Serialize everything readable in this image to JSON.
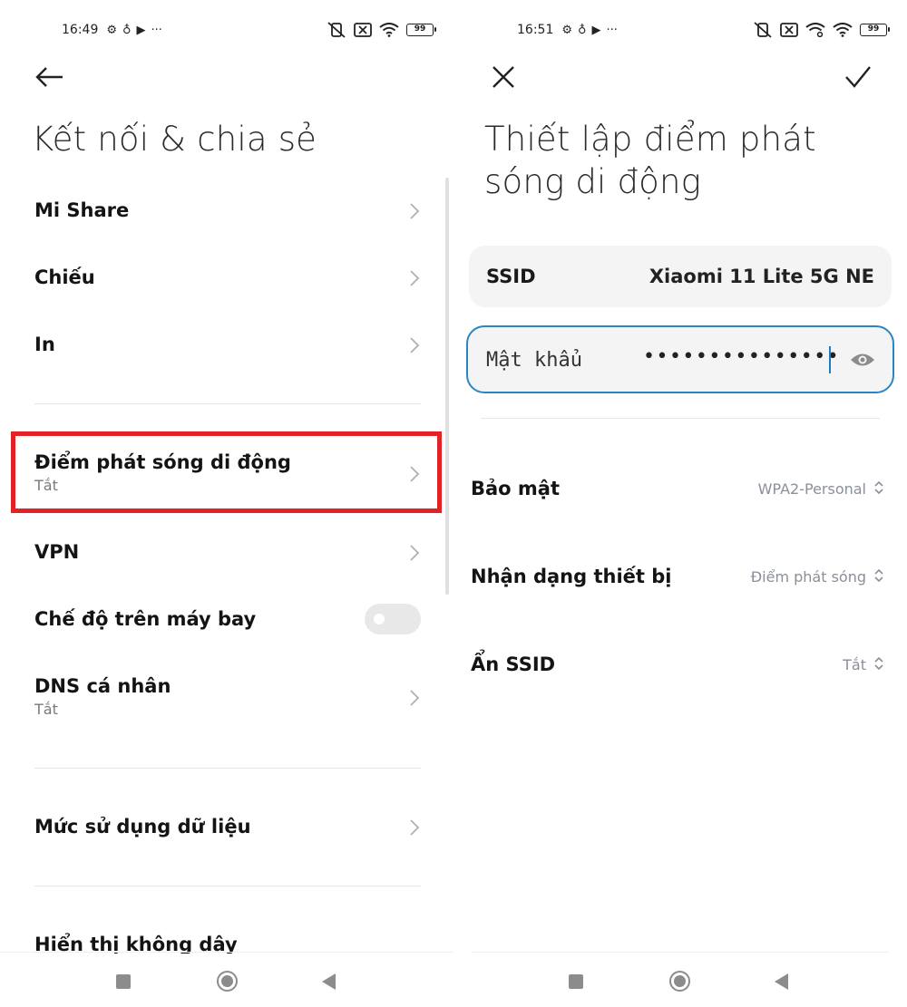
{
  "left": {
    "status": {
      "time": "16:49",
      "battery": "99"
    },
    "title": "Kết nối & chia sẻ",
    "items": [
      {
        "label": "Mi Share"
      },
      {
        "label": "Chiếu"
      },
      {
        "label": "In"
      },
      {
        "label": "Điểm phát sóng di động",
        "sub": "Tắt"
      },
      {
        "label": "VPN"
      },
      {
        "label": "Chế độ trên máy bay"
      },
      {
        "label": "DNS cá nhân",
        "sub": "Tắt"
      },
      {
        "label": "Mức sử dụng dữ liệu"
      },
      {
        "label": "Hiển thị không dây"
      }
    ],
    "airplane_mode_on": false
  },
  "right": {
    "status": {
      "time": "16:51",
      "battery": "99"
    },
    "title_line1": "Thiết lập điểm phát",
    "title_line2": "sóng di động",
    "ssid": {
      "label": "SSID",
      "value": "Xiaomi 11 Lite 5G NE"
    },
    "password": {
      "label": "Mật khẩu",
      "masked": "•••••••••••••••"
    },
    "rows": [
      {
        "label": "Bảo mật",
        "value": "WPA2-Personal"
      },
      {
        "label": "Nhận dạng thiết bị",
        "value": "Điểm phát sóng"
      },
      {
        "label": "Ẩn SSID",
        "value": "Tắt"
      }
    ]
  },
  "colors": {
    "highlight": "#e32227",
    "focus_border": "#2a86c2",
    "muted_value": "#8a8f99"
  }
}
